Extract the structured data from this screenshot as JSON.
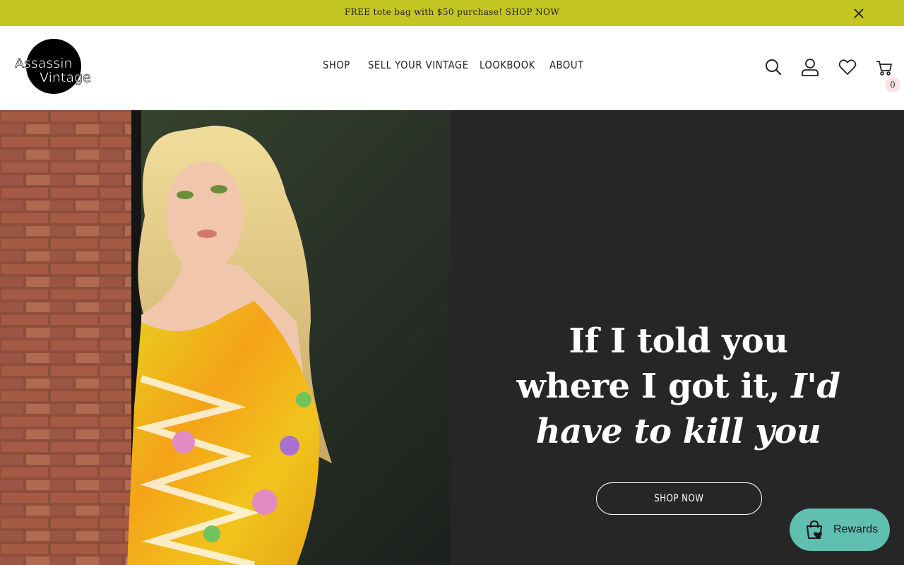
{
  "announcement": {
    "text": "FREE tote bag with $50 purchase! SHOP NOW"
  },
  "brand": {
    "logo_line1": "Assassin",
    "logo_line2": "Vintage"
  },
  "nav": {
    "items": [
      {
        "label": "SHOP"
      },
      {
        "label": "SELL YOUR VINTAGE"
      },
      {
        "label": "LOOKBOOK"
      },
      {
        "label": "ABOUT"
      }
    ]
  },
  "header_icons": {
    "icons": [
      "search-icon",
      "account-icon",
      "wishlist-icon",
      "cart-icon"
    ],
    "cart_count": "0"
  },
  "hero": {
    "headline_plain": "If I told you where I got it,",
    "headline_italic": "I'd have to kill you",
    "button_label": "SHOP NOW"
  },
  "rewards": {
    "label": "Rewards"
  },
  "colors": {
    "announcement_bg": "#c3c622",
    "hero_panel_bg": "#262626",
    "rewards_bg": "#5fbfb1"
  }
}
